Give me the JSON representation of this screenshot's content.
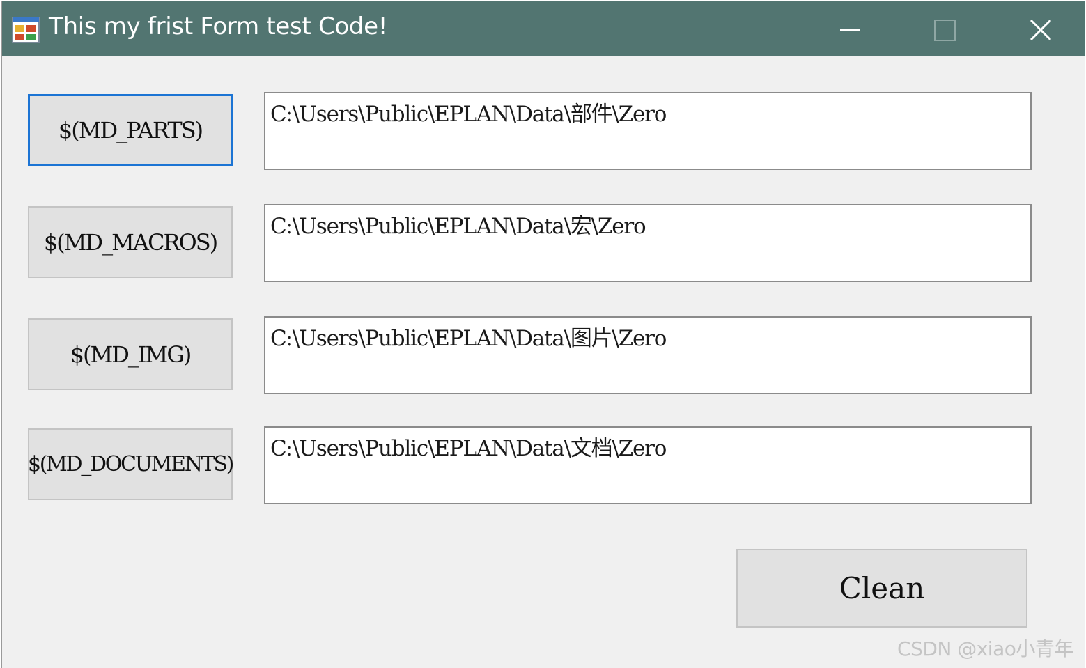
{
  "window": {
    "title": "This my frist Form test Code!",
    "controls": {
      "minimize_icon": "minimize-icon",
      "maximize_icon": "maximize-icon",
      "close_icon": "close-icon"
    },
    "titlebar_color": "#527571",
    "focus_color": "#1c74d4"
  },
  "rows": [
    {
      "button_label": "$(MD_PARTS)",
      "path_value": "C:\\Users\\Public\\EPLAN\\Data\\部件\\Zero"
    },
    {
      "button_label": "$(MD_MACROS)",
      "path_value": "C:\\Users\\Public\\EPLAN\\Data\\宏\\Zero"
    },
    {
      "button_label": "$(MD_IMG)",
      "path_value": "C:\\Users\\Public\\EPLAN\\Data\\图片\\Zero"
    },
    {
      "button_label": "$(MD_DOCUMENTS)",
      "path_value": "C:\\Users\\Public\\EPLAN\\Data\\文档\\Zero"
    }
  ],
  "actions": {
    "clean_label": "Clean"
  },
  "watermark": "CSDN @xiao小青年"
}
